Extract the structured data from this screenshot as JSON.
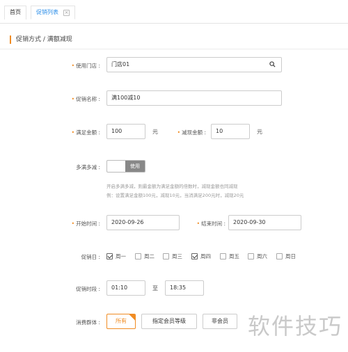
{
  "tabs": [
    {
      "label": "首页"
    },
    {
      "label": "促销列表",
      "close": "×"
    }
  ],
  "section_title": "促销方式 / 满额减现",
  "form": {
    "store": {
      "label": "使用门店 :",
      "value": "门店01"
    },
    "name": {
      "label": "促销名称 :",
      "value": "满100减10"
    },
    "threshold": {
      "label": "满足金额 :",
      "value": "100",
      "unit": "元"
    },
    "reduce": {
      "label": "减现金额 :",
      "value": "10",
      "unit": "元"
    },
    "multi": {
      "label": "多满多减 :",
      "toggle_label": "使用",
      "enabled": false
    },
    "hint_lines": [
      "开启多满多减，则最金额为满足金额的倍数时，减现金额也同减现",
      "例：设置满足金额100元，减现10元，当消满足200元时，减现20元"
    ],
    "start": {
      "label": "开始时间 :",
      "value": "2020-09-26"
    },
    "end": {
      "label": "结束时间 :",
      "value": "2020-09-30"
    },
    "days_label": "促销日 :",
    "days": [
      {
        "label": "周一",
        "checked": true
      },
      {
        "label": "周二",
        "checked": false
      },
      {
        "label": "周三",
        "checked": false
      },
      {
        "label": "周四",
        "checked": true
      },
      {
        "label": "周五",
        "checked": false
      },
      {
        "label": "周六",
        "checked": false
      },
      {
        "label": "周日",
        "checked": false
      }
    ],
    "period": {
      "label": "促销时段 :",
      "from": "01:10",
      "sep": "至",
      "to": "18:35"
    },
    "audience": {
      "label": "消费群体 :",
      "options": [
        {
          "label": "所有",
          "selected": true
        },
        {
          "label": "指定会员等级",
          "selected": false
        },
        {
          "label": "非会员",
          "selected": false
        }
      ]
    }
  },
  "watermark": "软件技巧",
  "colors": {
    "accent": "#f08c23",
    "tab_active": "#2c8ee8"
  }
}
